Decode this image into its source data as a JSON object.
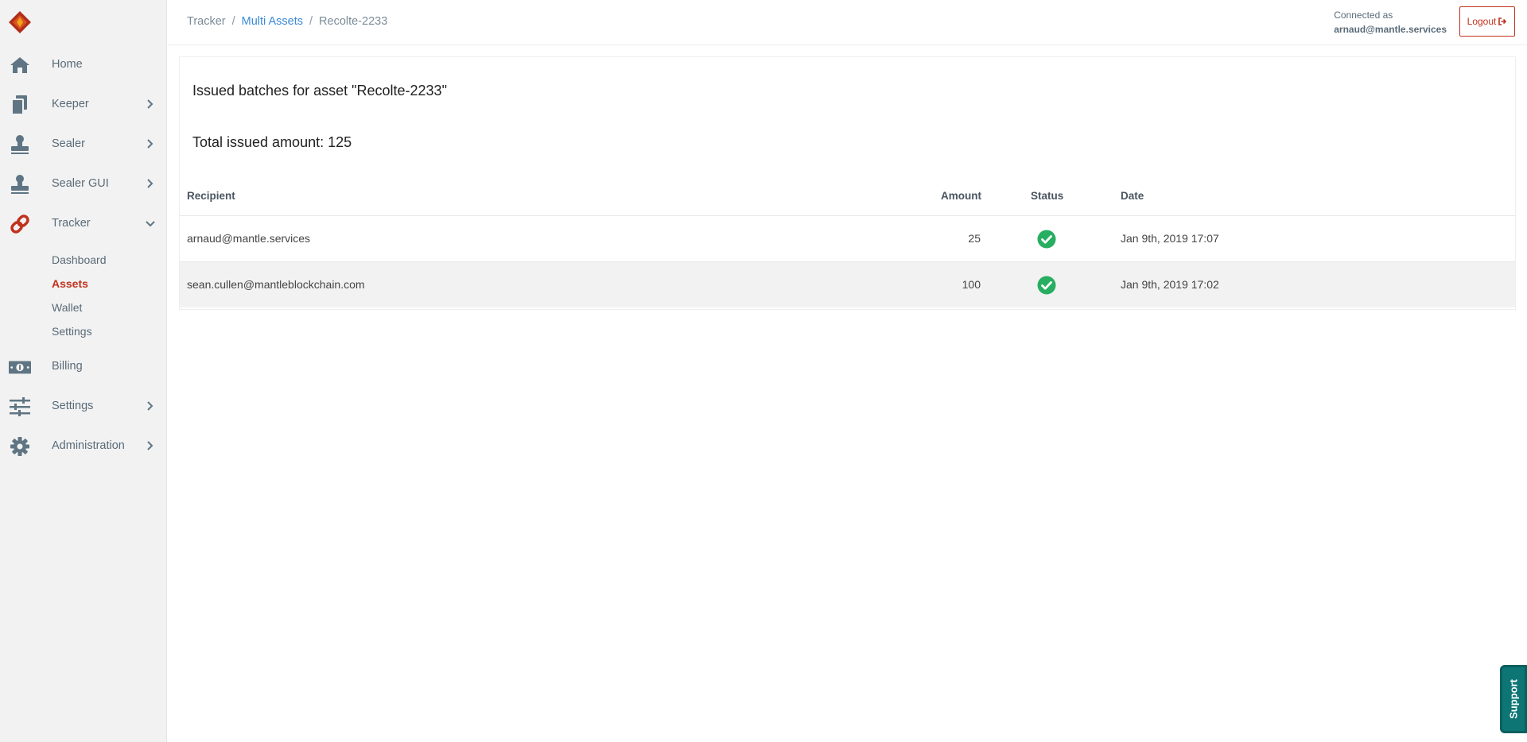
{
  "sidebar": {
    "items": [
      {
        "label": "Home",
        "icon": "home-icon"
      },
      {
        "label": "Keeper",
        "icon": "documents-icon"
      },
      {
        "label": "Sealer",
        "icon": "stamp-icon"
      },
      {
        "label": "Sealer GUI",
        "icon": "stamp-icon"
      },
      {
        "label": "Tracker",
        "icon": "link-icon"
      },
      {
        "label": "Billing",
        "icon": "money-icon"
      },
      {
        "label": "Settings",
        "icon": "sliders-icon"
      },
      {
        "label": "Administration",
        "icon": "gear-icon"
      }
    ],
    "tracker_sub": [
      "Dashboard",
      "Assets",
      "Wallet",
      "Settings"
    ],
    "active_sub": "Assets"
  },
  "breadcrumb": {
    "items": [
      "Tracker",
      "Multi Assets",
      "Recolte-2233"
    ],
    "separator": "/"
  },
  "header": {
    "connected_label": "Connected as",
    "user": "arnaud@mantle.services",
    "logout_label": "Logout"
  },
  "card": {
    "title": "Issued batches for asset \"Recolte-2233\"",
    "total": "Total issued amount: 125"
  },
  "table": {
    "headers": [
      "Recipient",
      "Amount",
      "Status",
      "Date"
    ],
    "rows": [
      {
        "recipient": "arnaud@mantle.services",
        "amount": "25",
        "status": "success",
        "date": "Jan 9th, 2019 17:07"
      },
      {
        "recipient": "sean.cullen@mantleblockchain.com",
        "amount": "100",
        "status": "success",
        "date": "Jan 9th, 2019 17:02"
      }
    ]
  },
  "support": {
    "label": "Support"
  },
  "colors": {
    "accent_red": "#c0321d",
    "link_blue": "#3a89d6",
    "icon_slate": "#5f7584",
    "success_green": "#27ae60",
    "support_teal": "#0e7575"
  }
}
